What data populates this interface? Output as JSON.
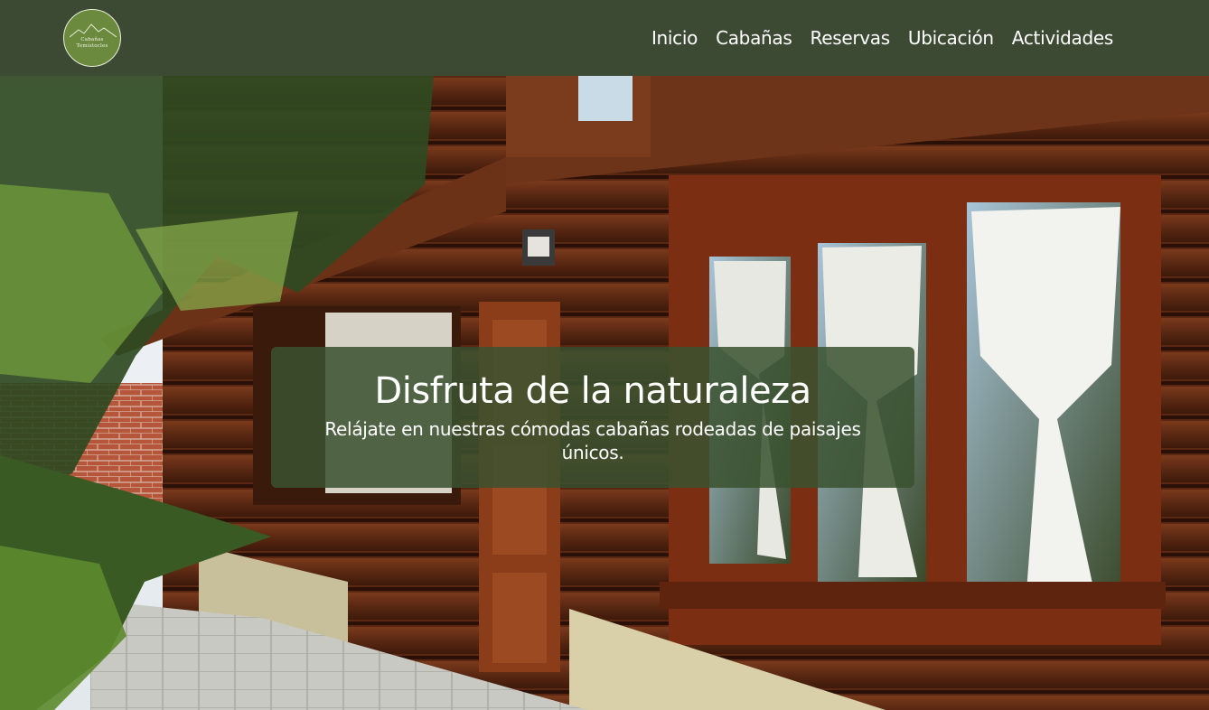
{
  "brand": {
    "logo_line1": "Cabañas",
    "logo_line2": "Temístocles",
    "logo_icon": "mountain-icon"
  },
  "nav": {
    "items": [
      {
        "label": "Inicio"
      },
      {
        "label": "Cabañas"
      },
      {
        "label": "Reservas"
      },
      {
        "label": "Ubicación"
      },
      {
        "label": "Actividades"
      }
    ]
  },
  "hero": {
    "title": "Disfruta de la naturaleza",
    "subtitle": "Relájate en nuestras cómodas cabañas rodeadas de paisajes únicos."
  },
  "colors": {
    "navbar": "#3d4a33",
    "caption_bg": "#3a5230",
    "text": "#ffffff"
  }
}
